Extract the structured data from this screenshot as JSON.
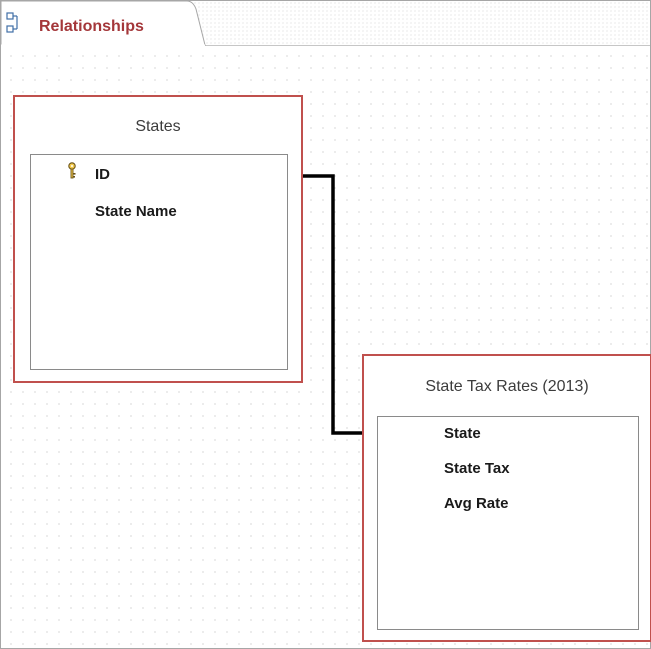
{
  "tab": {
    "label": "Relationships",
    "icon": "relationships-icon"
  },
  "tables": [
    {
      "title": "States",
      "fields": [
        {
          "name": "ID",
          "primary_key": true
        },
        {
          "name": "State Name",
          "primary_key": false
        }
      ]
    },
    {
      "title": "State Tax Rates (2013)",
      "fields": [
        {
          "name": "State",
          "primary_key": false
        },
        {
          "name": "State Tax",
          "primary_key": false
        },
        {
          "name": "Avg Rate",
          "primary_key": false
        }
      ]
    }
  ],
  "colors": {
    "table_border": "#c0504d",
    "tab_label": "#a4373a",
    "relationship_line": "#000000"
  }
}
